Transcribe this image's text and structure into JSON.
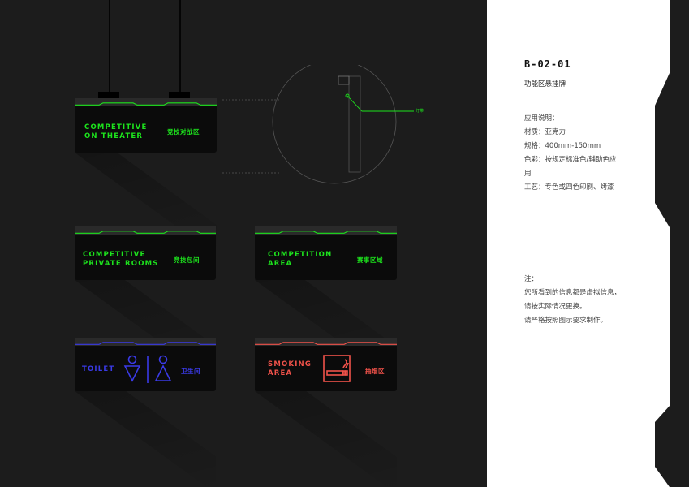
{
  "signs": {
    "theater": {
      "en_line1": "COMPETITIVE",
      "en_line2": "ON THEATER",
      "cn": "竞技对战区"
    },
    "private_rooms": {
      "en_line1": "COMPETITIVE",
      "en_line2": "PRIVATE ROOMS",
      "cn": "竞技包间"
    },
    "competition": {
      "en_line1": "COMPETITION",
      "en_line2": "AREA",
      "cn": "赛事区域"
    },
    "toilet": {
      "en": "TOILET",
      "cn": "卫生间"
    },
    "smoking": {
      "en_line1": "SMOKING",
      "en_line2": "AREA",
      "cn": "抽烟区"
    }
  },
  "detail": {
    "callout_label": "灯带"
  },
  "panel": {
    "code": "B-02-01",
    "title": "功能区悬挂牌",
    "spec_heading": "应用说明：",
    "spec_lines": [
      "材质：亚克力",
      "规格：400mm-150mm",
      "色彩：按规定标准色/辅助色应",
      "用",
      "工艺：专色或四色印刷、烤漆"
    ],
    "note_heading": "注：",
    "note_lines": [
      "您所看到的信息都是虚拟信息，",
      "请按实际情况更换。",
      "请严格按照图示要求制作。"
    ]
  },
  "colors": {
    "green": "#1de31d",
    "blue": "#3a3ae6",
    "red": "#f0524a",
    "panel": "#ffffff",
    "background": "#1c1c1c"
  }
}
